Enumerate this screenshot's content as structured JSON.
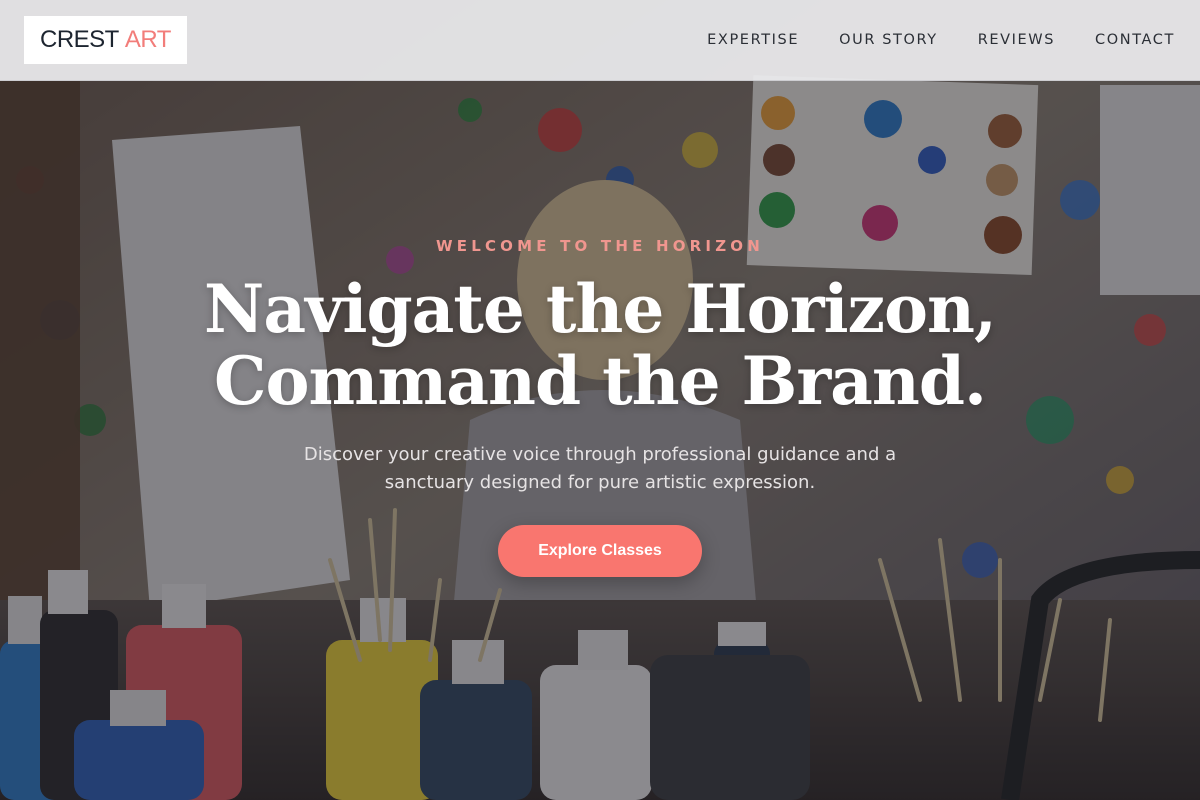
{
  "brand": {
    "name": "CREST",
    "accent": "ART",
    "accent_color": "#f27d7a"
  },
  "nav": {
    "items": [
      {
        "label": "EXPERTISE"
      },
      {
        "label": "OUR STORY"
      },
      {
        "label": "REVIEWS"
      },
      {
        "label": "CONTACT"
      }
    ]
  },
  "hero": {
    "eyebrow": "WELCOME TO THE HORIZON",
    "headline_line1": "Navigate the Horizon,",
    "headline_line2": "Command the Brand.",
    "subtext": "Discover your creative voice through professional guidance and a sanctuary designed for pure artistic expression.",
    "cta_label": "Explore Classes",
    "cta_color": "#f9766f",
    "background_description_icon": "art-studio-photo"
  }
}
